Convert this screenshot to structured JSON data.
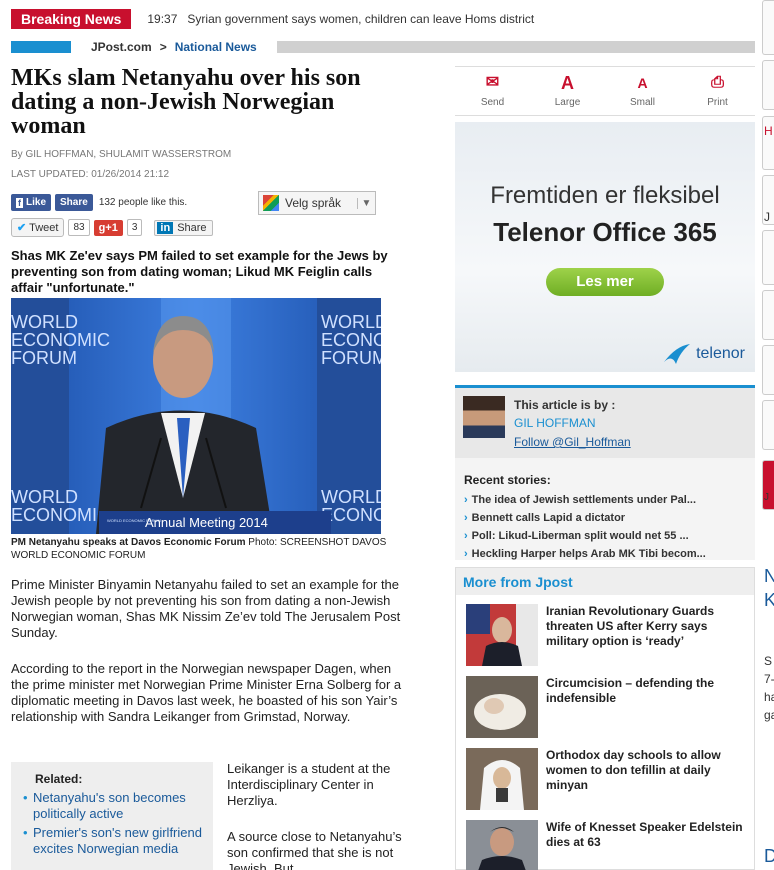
{
  "ticker": {
    "label": "Breaking News",
    "time": "19:37",
    "text": "Syrian government says women, children can leave Homs district"
  },
  "breadcrumb": {
    "site": "JPost.com",
    "separator": ">",
    "section": "National News"
  },
  "article": {
    "headline": "MKs slam Netanyahu over his son dating a non-Jewish Norwegian woman",
    "byline": "By GIL HOFFMAN, SHULAMIT WASSERSTROM",
    "updated": "LAST UPDATED: 01/26/2014 21:12",
    "summary": "Shas MK Ze'ev says PM failed to set example for the Jews by preventing son from dating woman; Likud MK Feiglin calls affair \"unfortunate.\"",
    "photo": {
      "caption_bold": "PM Netanyahu speaks at Davos Economic Forum",
      "caption_credit": " Photo: SCREENSHOT DAVOS WORLD ECONOMIC FORUM",
      "banner_left": "WORLD ECONOMIC FORUM",
      "banner_text": "Annual Meeting 2014",
      "backdrop_lines": [
        "WORLD",
        "ECONOMIC",
        "FORUM"
      ]
    },
    "paragraph1": "Prime Minister Binyamin Netanyahu failed to set an example for the Jewish people by not preventing his son from dating a non-Jewish Norwegian woman, Shas MK Nissim Ze’ev told The Jerusalem Post Sunday.",
    "paragraph2": "According to the report in the Norwegian newspaper Dagen, when the prime minister met Norwegian Prime Minister Erna Solberg for a diplomatic meeting in Davos last week, he boasted of his son Yair’s relationship with Sandra Leikanger from Grimstad, Norway.",
    "paragraph3": "Leikanger is a student at the Interdisciplinary Center in Herzliya.",
    "paragraph4": "A source close to Netanyahu’s son confirmed that she is not Jewish. But"
  },
  "social": {
    "like": "Like",
    "share": "Share",
    "like_count": "132 people like this.",
    "tweet": "Tweet",
    "tweet_count": "83",
    "gplus": "+1",
    "gplus_count": "3",
    "linkedin_share": "Share",
    "translate": "Velg språk"
  },
  "related": {
    "title": "Related:",
    "items": [
      "Netanyahu's son becomes politically active",
      "Premier's son's new girlfriend excites Norwegian media"
    ]
  },
  "tools": {
    "send": "Send",
    "large": "Large",
    "small": "Small",
    "print": "Print"
  },
  "ad": {
    "line1": "Fremtiden er fleksibel",
    "line2": "Telenor Office 365",
    "button": "Les mer",
    "brand": "telenor"
  },
  "author": {
    "by": "This article is by :",
    "name": "GIL HOFFMAN",
    "follow": "Follow @Gil_Hoffman"
  },
  "recent": {
    "title": "Recent stories:",
    "items": [
      "The idea of Jewish settlements under Pal...",
      "Bennett calls Lapid a dictator",
      "Poll: Likud-Liberman split would net 55 ...",
      "Heckling Harper helps Arab MK Tibi becom..."
    ]
  },
  "more": {
    "title": "More from Jpost",
    "items": [
      "Iranian Revolutionary Guards threaten US after Kerry says military option is ‘ready’",
      "Circumcision – defending the indefensible",
      "Orthodox day schools to allow women to don tefillin at daily minyan",
      "Wife of Knesset Speaker Edelstein dies at 63"
    ]
  },
  "edge": {
    "chars": [
      "H",
      "J",
      "J",
      "N",
      "K",
      "S",
      "7-",
      "ha",
      "ga",
      "D"
    ]
  },
  "colors": {
    "brand_red": "#c8102e",
    "accent_blue": "#1a8fd0",
    "link_blue": "#1a5a9a"
  }
}
